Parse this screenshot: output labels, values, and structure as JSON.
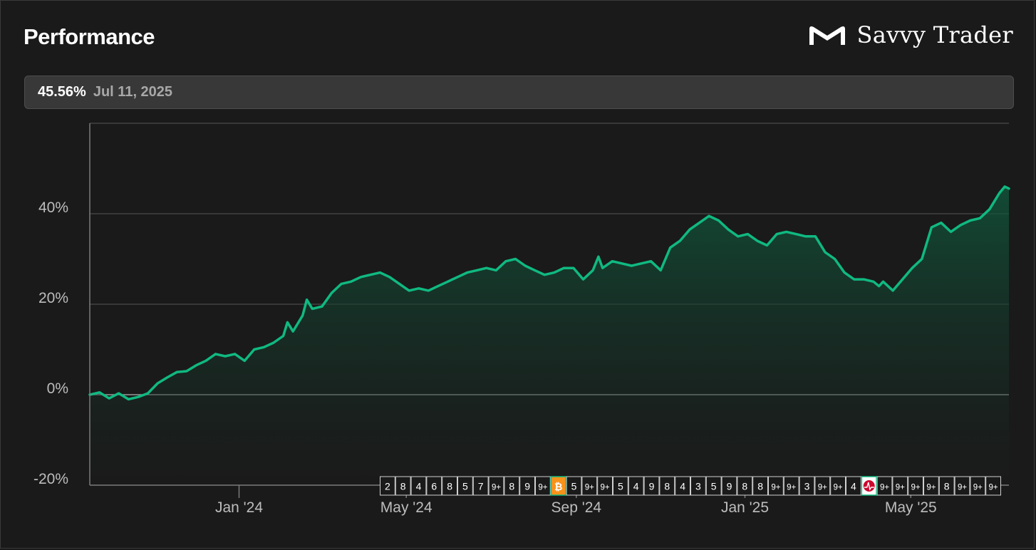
{
  "header": {
    "title": "Performance",
    "brand_name": "Savvy Trader",
    "brand_icon": "savvy-trader-logo-icon"
  },
  "tooltip": {
    "value": "45.56%",
    "date": "Jul 11, 2025"
  },
  "colors": {
    "line": "#10b981",
    "background": "#1a1a1a",
    "grid": "#4a4a4a",
    "zero_line": "#9a9a9a"
  },
  "chart_data": {
    "type": "area",
    "title": "Performance",
    "xlabel": "",
    "ylabel": "",
    "ylim": [
      -20,
      60
    ],
    "y_ticks": [
      -20,
      0,
      20,
      40
    ],
    "y_tick_labels": [
      "-20%",
      "0%",
      "20%",
      "40%"
    ],
    "x_range": [
      "2023-09-15",
      "2025-07-11"
    ],
    "x_ticks": [
      "2024-01-01",
      "2024-05-01",
      "2024-09-01",
      "2025-01-01",
      "2025-05-01"
    ],
    "x_tick_labels": [
      "Jan '24",
      "May '24",
      "Sep '24",
      "Jan '25",
      "May '25"
    ],
    "grid": true,
    "series": [
      {
        "values_unit": "percent",
        "points": [
          [
            "2023-09-15",
            0.0
          ],
          [
            "2023-09-22",
            0.5
          ],
          [
            "2023-09-29",
            -0.8
          ],
          [
            "2023-10-06",
            0.3
          ],
          [
            "2023-10-13",
            -1.0
          ],
          [
            "2023-10-20",
            -0.5
          ],
          [
            "2023-10-27",
            0.3
          ],
          [
            "2023-11-03",
            2.5
          ],
          [
            "2023-11-10",
            3.8
          ],
          [
            "2023-11-17",
            5.0
          ],
          [
            "2023-11-24",
            5.2
          ],
          [
            "2023-12-01",
            6.5
          ],
          [
            "2023-12-08",
            7.5
          ],
          [
            "2023-12-15",
            9.0
          ],
          [
            "2023-12-22",
            8.5
          ],
          [
            "2023-12-29",
            9.0
          ],
          [
            "2024-01-05",
            7.5
          ],
          [
            "2024-01-12",
            10.0
          ],
          [
            "2024-01-19",
            10.5
          ],
          [
            "2024-01-26",
            11.5
          ],
          [
            "2024-02-02",
            13.0
          ],
          [
            "2024-02-05",
            16.0
          ],
          [
            "2024-02-09",
            14.0
          ],
          [
            "2024-02-16",
            17.5
          ],
          [
            "2024-02-19",
            21.0
          ],
          [
            "2024-02-23",
            19.0
          ],
          [
            "2024-03-01",
            19.5
          ],
          [
            "2024-03-08",
            22.5
          ],
          [
            "2024-03-15",
            24.5
          ],
          [
            "2024-03-22",
            25.0
          ],
          [
            "2024-03-29",
            26.0
          ],
          [
            "2024-04-05",
            26.5
          ],
          [
            "2024-04-12",
            27.0
          ],
          [
            "2024-04-19",
            26.0
          ],
          [
            "2024-04-26",
            24.5
          ],
          [
            "2024-05-03",
            23.0
          ],
          [
            "2024-05-10",
            23.5
          ],
          [
            "2024-05-17",
            23.0
          ],
          [
            "2024-05-24",
            24.0
          ],
          [
            "2024-05-31",
            25.0
          ],
          [
            "2024-06-07",
            26.0
          ],
          [
            "2024-06-14",
            27.0
          ],
          [
            "2024-06-21",
            27.5
          ],
          [
            "2024-06-28",
            28.0
          ],
          [
            "2024-07-05",
            27.5
          ],
          [
            "2024-07-12",
            29.5
          ],
          [
            "2024-07-19",
            30.0
          ],
          [
            "2024-07-26",
            28.5
          ],
          [
            "2024-08-02",
            27.5
          ],
          [
            "2024-08-09",
            26.5
          ],
          [
            "2024-08-16",
            27.0
          ],
          [
            "2024-08-23",
            28.0
          ],
          [
            "2024-08-30",
            28.0
          ],
          [
            "2024-09-06",
            25.5
          ],
          [
            "2024-09-13",
            27.5
          ],
          [
            "2024-09-17",
            30.5
          ],
          [
            "2024-09-20",
            28.0
          ],
          [
            "2024-09-27",
            29.5
          ],
          [
            "2024-10-04",
            29.0
          ],
          [
            "2024-10-11",
            28.5
          ],
          [
            "2024-10-18",
            29.0
          ],
          [
            "2024-10-25",
            29.5
          ],
          [
            "2024-11-01",
            27.5
          ],
          [
            "2024-11-08",
            32.5
          ],
          [
            "2024-11-15",
            34.0
          ],
          [
            "2024-11-22",
            36.5
          ],
          [
            "2024-11-29",
            38.0
          ],
          [
            "2024-12-06",
            39.5
          ],
          [
            "2024-12-13",
            38.5
          ],
          [
            "2024-12-20",
            36.5
          ],
          [
            "2024-12-27",
            35.0
          ],
          [
            "2025-01-03",
            35.5
          ],
          [
            "2025-01-10",
            34.0
          ],
          [
            "2025-01-17",
            33.0
          ],
          [
            "2025-01-24",
            35.5
          ],
          [
            "2025-01-31",
            36.0
          ],
          [
            "2025-02-07",
            35.5
          ],
          [
            "2025-02-14",
            35.0
          ],
          [
            "2025-02-21",
            35.0
          ],
          [
            "2025-02-28",
            31.5
          ],
          [
            "2025-03-07",
            30.0
          ],
          [
            "2025-03-14",
            27.0
          ],
          [
            "2025-03-21",
            25.5
          ],
          [
            "2025-03-28",
            25.5
          ],
          [
            "2025-04-04",
            25.0
          ],
          [
            "2025-04-08",
            24.0
          ],
          [
            "2025-04-11",
            25.0
          ],
          [
            "2025-04-18",
            23.0
          ],
          [
            "2025-04-25",
            25.5
          ],
          [
            "2025-05-02",
            28.0
          ],
          [
            "2025-05-09",
            30.0
          ],
          [
            "2025-05-16",
            37.0
          ],
          [
            "2025-05-23",
            38.0
          ],
          [
            "2025-05-30",
            36.0
          ],
          [
            "2025-06-06",
            37.5
          ],
          [
            "2025-06-13",
            38.5
          ],
          [
            "2025-06-20",
            39.0
          ],
          [
            "2025-06-27",
            41.0
          ],
          [
            "2025-07-04",
            44.5
          ],
          [
            "2025-07-08",
            46.0
          ],
          [
            "2025-07-11",
            45.56
          ]
        ]
      }
    ],
    "event_markers": [
      {
        "date": "2024-05-01",
        "label": "2"
      },
      {
        "date": "2024-05-12",
        "label": "8"
      },
      {
        "date": "2024-05-24",
        "label": "4"
      },
      {
        "date": "2024-06-05",
        "label": "6"
      },
      {
        "date": "2024-06-17",
        "label": "8"
      },
      {
        "date": "2024-06-29",
        "label": "5"
      },
      {
        "date": "2024-07-11",
        "label": "7"
      },
      {
        "date": "2024-07-23",
        "label": "9+"
      },
      {
        "date": "2024-08-04",
        "label": "8"
      },
      {
        "date": "2024-08-16",
        "label": "9"
      },
      {
        "date": "2024-08-28",
        "label": "9+"
      },
      {
        "date": "2024-09-09",
        "label": "",
        "icon": "bitcoin-icon"
      },
      {
        "date": "2024-09-21",
        "label": "5"
      },
      {
        "date": "2024-10-03",
        "label": "9+"
      },
      {
        "date": "2024-10-15",
        "label": "9+"
      },
      {
        "date": "2024-10-27",
        "label": "5"
      },
      {
        "date": "2024-11-08",
        "label": "4"
      },
      {
        "date": "2024-11-20",
        "label": "9"
      },
      {
        "date": "2024-12-02",
        "label": "8"
      },
      {
        "date": "2024-12-14",
        "label": "4"
      },
      {
        "date": "2024-12-26",
        "label": "3"
      },
      {
        "date": "2025-01-07",
        "label": "5"
      },
      {
        "date": "2025-01-19",
        "label": "9"
      },
      {
        "date": "2025-01-31",
        "label": "8"
      },
      {
        "date": "2025-02-12",
        "label": "8"
      },
      {
        "date": "2025-02-24",
        "label": "9+"
      },
      {
        "date": "2025-03-08",
        "label": "9+"
      },
      {
        "date": "2025-03-20",
        "label": "3"
      },
      {
        "date": "2025-04-01",
        "label": "9+"
      },
      {
        "date": "2025-04-13",
        "label": "9+"
      },
      {
        "date": "2025-04-25",
        "label": "4"
      },
      {
        "date": "2025-05-07",
        "label": "",
        "icon": "broadcom-logo-icon"
      },
      {
        "date": "2025-05-19",
        "label": "9+"
      },
      {
        "date": "2025-05-31",
        "label": "9+"
      },
      {
        "date": "2025-06-12",
        "label": "9+"
      },
      {
        "date": "2025-06-24",
        "label": "9+"
      },
      {
        "date": "2025-07-06",
        "label": "8"
      },
      {
        "date": "2025-07-18",
        "label": "9+"
      },
      {
        "date": "2025-07-30",
        "label": "9+"
      },
      {
        "date": "2025-08-11",
        "label": "9+"
      },
      {
        "date": "2025-08-23",
        "label": "9+"
      }
    ]
  }
}
